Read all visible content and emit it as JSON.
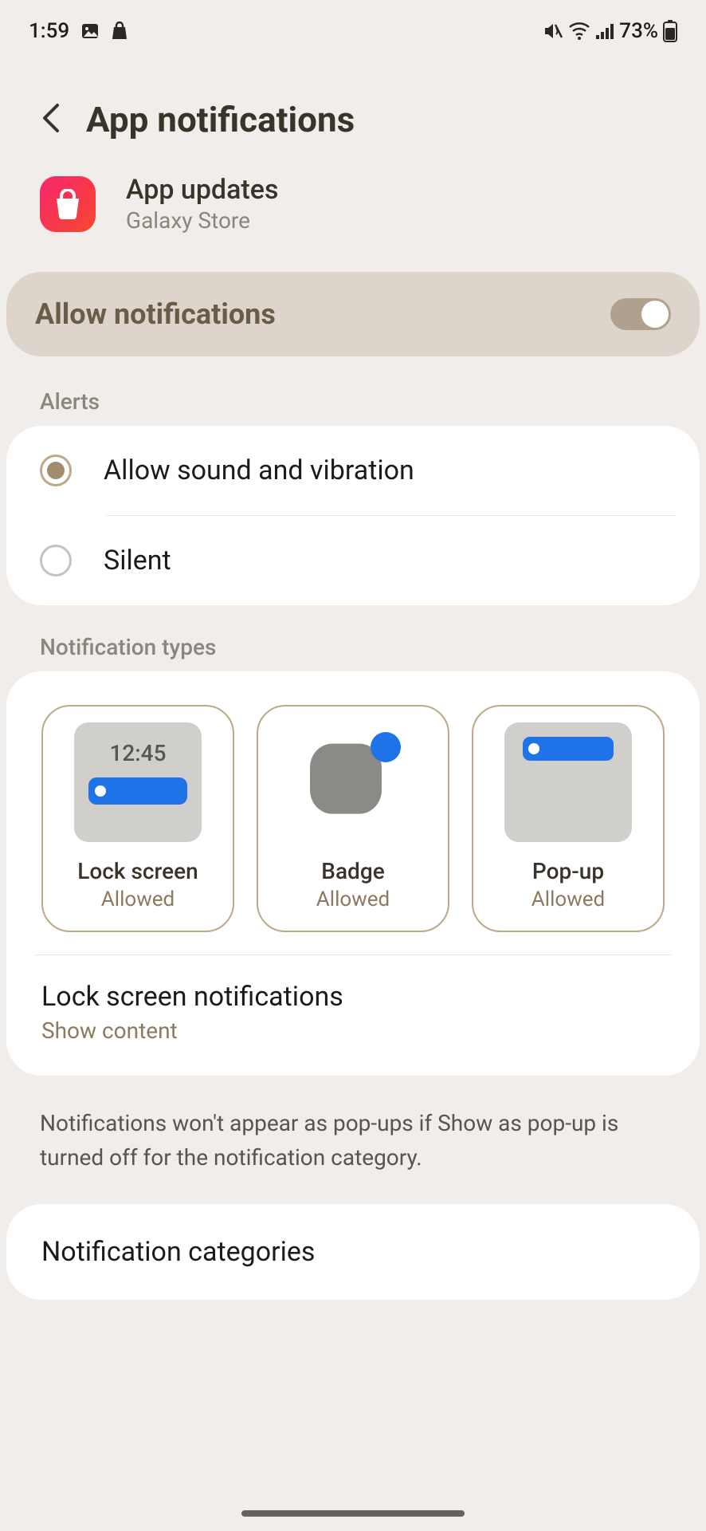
{
  "status": {
    "time": "1:59",
    "battery": "73%"
  },
  "header": {
    "title": "App notifications"
  },
  "app": {
    "name": "App updates",
    "source": "Galaxy Store"
  },
  "allow": {
    "label": "Allow notifications",
    "enabled": true
  },
  "sections": {
    "alerts_label": "Alerts",
    "types_label": "Notification types"
  },
  "alerts": {
    "options": [
      {
        "label": "Allow sound and vibration",
        "selected": true
      },
      {
        "label": "Silent",
        "selected": false
      }
    ]
  },
  "types": {
    "lockscreen": {
      "title": "Lock screen",
      "status": "Allowed",
      "preview_time": "12:45"
    },
    "badge": {
      "title": "Badge",
      "status": "Allowed"
    },
    "popup": {
      "title": "Pop-up",
      "status": "Allowed"
    }
  },
  "lockscreen_setting": {
    "title": "Lock screen notifications",
    "subtitle": "Show content"
  },
  "info": "Notifications won't appear as pop-ups if Show as pop-up is turned off for the notification category.",
  "categories": {
    "title": "Notification categories"
  }
}
